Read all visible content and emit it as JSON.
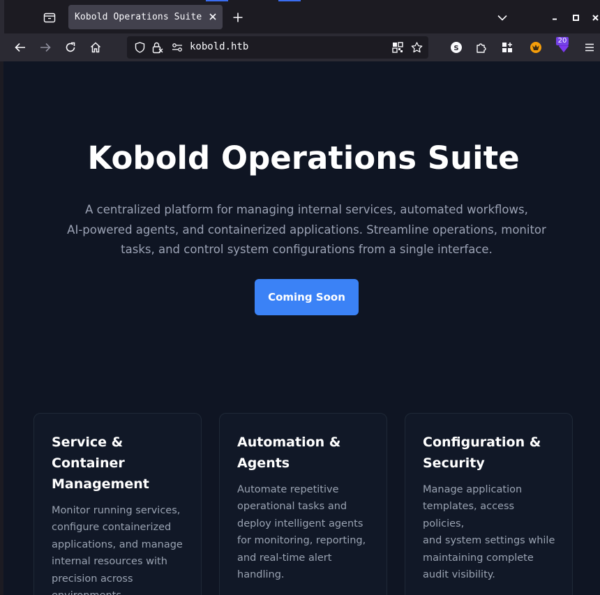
{
  "browser": {
    "tab_title": "Kobold Operations Suite",
    "url": "kobold.htb",
    "extension_badge": "20"
  },
  "icons": {
    "tabs_list": "tabs-list-icon",
    "tab_close": "close-icon",
    "new_tab": "plus-icon",
    "all_tabs": "chevron-down-icon",
    "minimize": "minimize-icon",
    "maximize": "maximize-icon",
    "close_window": "close-window-icon",
    "back": "back-arrow-icon",
    "forward": "forward-arrow-icon",
    "reload": "reload-icon",
    "home": "home-icon",
    "tracking_protection": "shield-icon",
    "site_security": "lock-icon",
    "permissions": "permissions-icon",
    "qr_code": "qr-code-icon",
    "bookmark": "star-icon",
    "profile": "profile-s-icon",
    "extensions": "puzzle-icon",
    "apps": "grid-icon",
    "fox_extension": "fox-extension-icon",
    "gem_extension": "gem-extension-icon",
    "menu": "hamburger-menu-icon"
  },
  "colors": {
    "page_background": "#0f1523",
    "accent": "#3b82f6",
    "card_background": "#111827",
    "heading": "#ffffff",
    "body_text": "#9ca3b5"
  },
  "hero": {
    "title": "Kobold Operations Suite",
    "description_lines": [
      "A centralized platform for managing internal services, automated workflows,",
      "AI-powered agents, and containerized applications. Streamline operations, monitor",
      "tasks, and control system configurations from a single interface."
    ],
    "cta_label": "Coming Soon"
  },
  "cards": [
    {
      "title_lines": [
        "Service & Container",
        "Management"
      ],
      "text_lines": [
        "Monitor running services,",
        "configure containerized",
        "applications, and manage",
        "internal resources with",
        "precision across",
        "environments."
      ]
    },
    {
      "title_lines": [
        "Automation &",
        "Agents"
      ],
      "text_lines": [
        "Automate repetitive",
        "operational tasks and",
        "deploy intelligent agents",
        "for monitoring, reporting,",
        "and real-time alert",
        "handling."
      ]
    },
    {
      "title_lines": [
        "Configuration &",
        "Security"
      ],
      "text_lines": [
        "Manage application",
        "templates, access policies,",
        "and system settings while",
        "maintaining complete",
        "audit visibility."
      ]
    }
  ]
}
